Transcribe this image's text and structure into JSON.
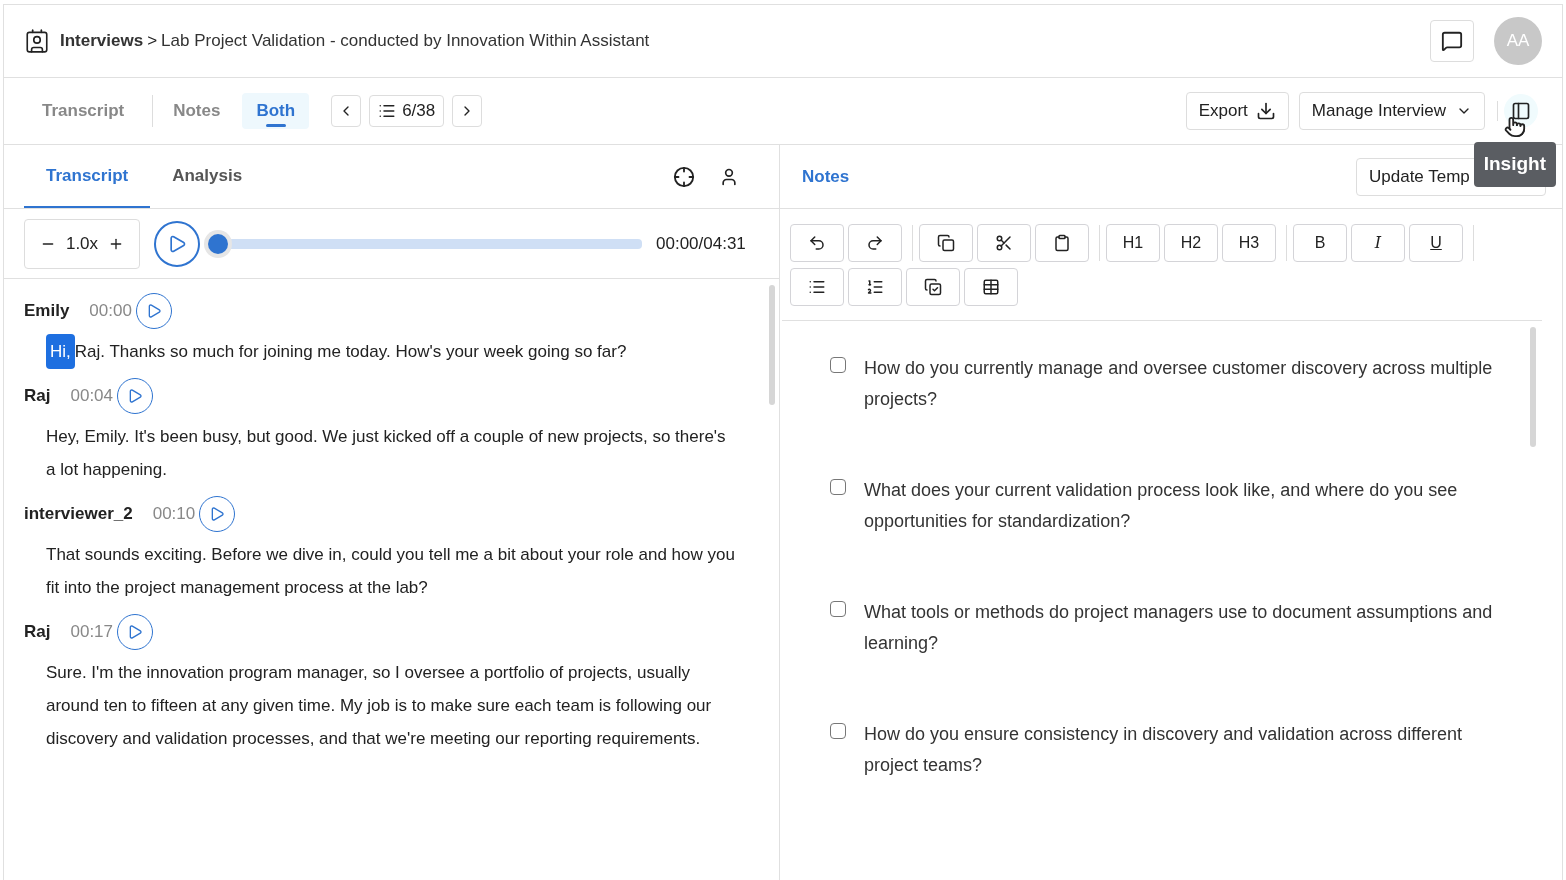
{
  "header": {
    "breadcrumb_root": "Interviews",
    "separator": ">",
    "title": "Lab Project Validation - conducted by Innovation Within Assistant",
    "avatar": "AA"
  },
  "view_tabs": [
    {
      "label": "Transcript",
      "selected": false
    },
    {
      "label": "Notes",
      "selected": false
    },
    {
      "label": "Both",
      "selected": true
    }
  ],
  "pager": {
    "position": "6/38"
  },
  "actions": {
    "export": "Export",
    "manage": "Manage Interview",
    "tooltip": "Insight"
  },
  "left_tabs": [
    {
      "label": "Transcript",
      "selected": true
    },
    {
      "label": "Analysis",
      "selected": false
    }
  ],
  "player": {
    "speed": "1.0x",
    "time": "00:00/04:31",
    "level": 0
  },
  "transcript": [
    {
      "speaker": "Emily",
      "time": "00:00",
      "highlight": "Hi,",
      "text": "Raj. Thanks so much for joining me today. How's your week going so far?"
    },
    {
      "speaker": "Raj",
      "time": "00:04",
      "text": "Hey, Emily. It's been busy, but good. We just kicked off a couple of new projects, so there's a lot happening."
    },
    {
      "speaker": "interviewer_2",
      "time": "00:10",
      "text": "That sounds exciting. Before we dive in, could you tell me a bit about your role and how you fit into the project management process at the lab?"
    },
    {
      "speaker": "Raj",
      "time": "00:17",
      "text": "Sure. I'm the innovation program manager, so I oversee a portfolio of projects, usually around ten to fifteen at any given time. My job is to make sure each team is following our discovery and validation processes, and that we're meeting our reporting requirements."
    }
  ],
  "notes": {
    "title": "Notes",
    "template_button": "Update Temp"
  },
  "toolbar": [
    {
      "kind": "undo"
    },
    {
      "kind": "redo"
    },
    {
      "kind": "sep"
    },
    {
      "kind": "copy"
    },
    {
      "kind": "cut"
    },
    {
      "kind": "paste"
    },
    {
      "kind": "sep"
    },
    {
      "kind": "text",
      "label": "H1"
    },
    {
      "kind": "text",
      "label": "H2"
    },
    {
      "kind": "text",
      "label": "H3"
    },
    {
      "kind": "sep"
    },
    {
      "kind": "bold",
      "label": "B"
    },
    {
      "kind": "italic",
      "label": "I"
    },
    {
      "kind": "underline",
      "label": "U"
    },
    {
      "kind": "sep"
    },
    {
      "kind": "bullets"
    },
    {
      "kind": "numbers"
    },
    {
      "kind": "checklist"
    },
    {
      "kind": "table"
    }
  ],
  "questions": [
    {
      "text": "How do you currently manage and oversee customer discovery across multiple projects?",
      "checked": false
    },
    {
      "text": "What does your current validation process look like, and where do you see opportunities for standardization?",
      "checked": false
    },
    {
      "text": "What tools or methods do project managers use to document assumptions and learning?",
      "checked": false
    },
    {
      "text": "How do you ensure consistency in discovery and validation across different project teams?",
      "checked": false
    }
  ]
}
